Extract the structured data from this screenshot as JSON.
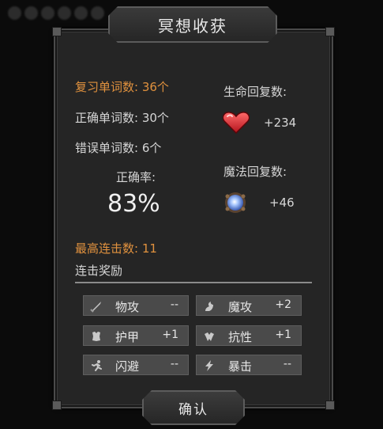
{
  "title": "冥想收获",
  "stats": {
    "review_words": "复习单词数: 36个",
    "correct_words": "正确单词数: 30个",
    "wrong_words": "错误单词数: 6个",
    "accuracy_label": "正确率:",
    "accuracy_value": "83%",
    "max_combo": "最高连击数: 11"
  },
  "recovery": {
    "hp_label": "生命回复数:",
    "hp_value": "+234",
    "mp_label": "魔法回复数:",
    "mp_value": "+46"
  },
  "combo_reward": {
    "label": "连击奖励",
    "items": [
      {
        "name": "物攻",
        "value": "--",
        "icon": "sword-icon"
      },
      {
        "name": "魔攻",
        "value": "+2",
        "icon": "magic-attack-icon"
      },
      {
        "name": "护甲",
        "value": "+1",
        "icon": "armor-icon"
      },
      {
        "name": "抗性",
        "value": "+1",
        "icon": "resistance-icon"
      },
      {
        "name": "闪避",
        "value": "--",
        "icon": "dodge-icon"
      },
      {
        "name": "暴击",
        "value": "--",
        "icon": "critical-icon"
      }
    ]
  },
  "confirm_label": "确认",
  "colors": {
    "accent_orange": "#e0913e",
    "panel_bg": "#252525",
    "tile_bg": "#4a4a4a"
  }
}
